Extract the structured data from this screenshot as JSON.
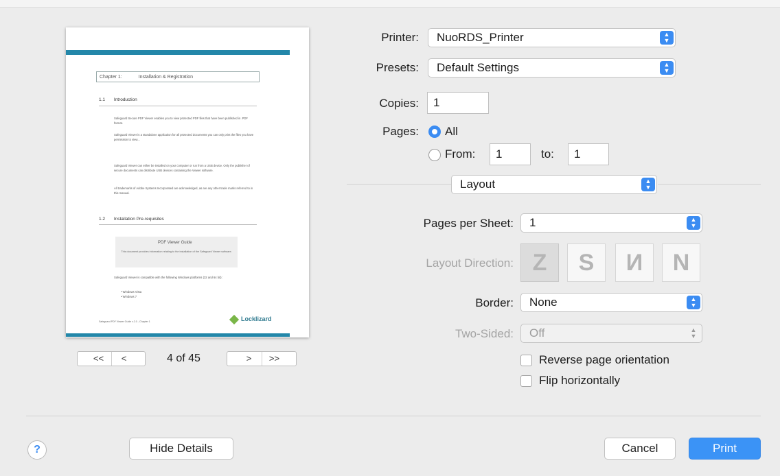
{
  "preview": {
    "chapter_num": "Chapter 1:",
    "chapter_title": "Installation & Registration",
    "sec1_num": "1.1",
    "sec1_title": "Introduction",
    "para1": "Safeguard Secure PDF Viewer enables you to view protected PDF files that have been published in .PDF format.",
    "para2": "Safeguard Viewer is a standalone application for all protected documents you can only print the files you have permission to view...",
    "para3": "Safeguard Viewer can either be installed on your computer or run from a USB device. Only the publisher of secure documents can distribute USB devices containing the Viewer software.",
    "para4": "All trademarks of Adobe Systems Incorporated are acknowledged, as are any other trade marks referred to in this manual.",
    "sec2_num": "1.2",
    "sec2_title": "Installation Pre-requisites",
    "figure_logo": "PDF Viewer Guide",
    "figure_caption": "This document provides information relating to the installation of the Safeguard Viewer software.",
    "para5": "Safeguard Viewer is compatible with the following Windows platforms (32 and 64 bit):",
    "bullet1": "Windows Vista",
    "bullet2": "Windows 7",
    "footer": "Safeguard PDF Viewer Guide v.2.0 - Chapter 1",
    "brand": "Locklizard"
  },
  "pager": {
    "first": "<<",
    "prev": "<",
    "next": ">",
    "last": ">>",
    "status": "4 of 45"
  },
  "printer": {
    "label": "Printer:",
    "value": "NuoRDS_Printer"
  },
  "presets": {
    "label": "Presets:",
    "value": "Default Settings"
  },
  "copies": {
    "label": "Copies:",
    "value": "1"
  },
  "pages": {
    "label": "Pages:",
    "all_label": "All",
    "from_label": "From:",
    "from_value": "1",
    "to_label": "to:",
    "to_value": "1"
  },
  "section_popup": {
    "value": "Layout"
  },
  "pages_per_sheet": {
    "label": "Pages per Sheet:",
    "value": "1"
  },
  "layout_direction": {
    "label": "Layout Direction:",
    "options": [
      "Z",
      "S",
      "N",
      "N"
    ]
  },
  "border": {
    "label": "Border:",
    "value": "None"
  },
  "two_sided": {
    "label": "Two-Sided:",
    "value": "Off"
  },
  "reverse_orientation": {
    "label": "Reverse page orientation"
  },
  "flip_horizontal": {
    "label": "Flip horizontally"
  },
  "buttons": {
    "help": "?",
    "hide_details": "Hide Details",
    "cancel": "Cancel",
    "print": "Print"
  },
  "colors": {
    "accent": "#3b8cf2",
    "preview_bar": "#2387a9"
  }
}
